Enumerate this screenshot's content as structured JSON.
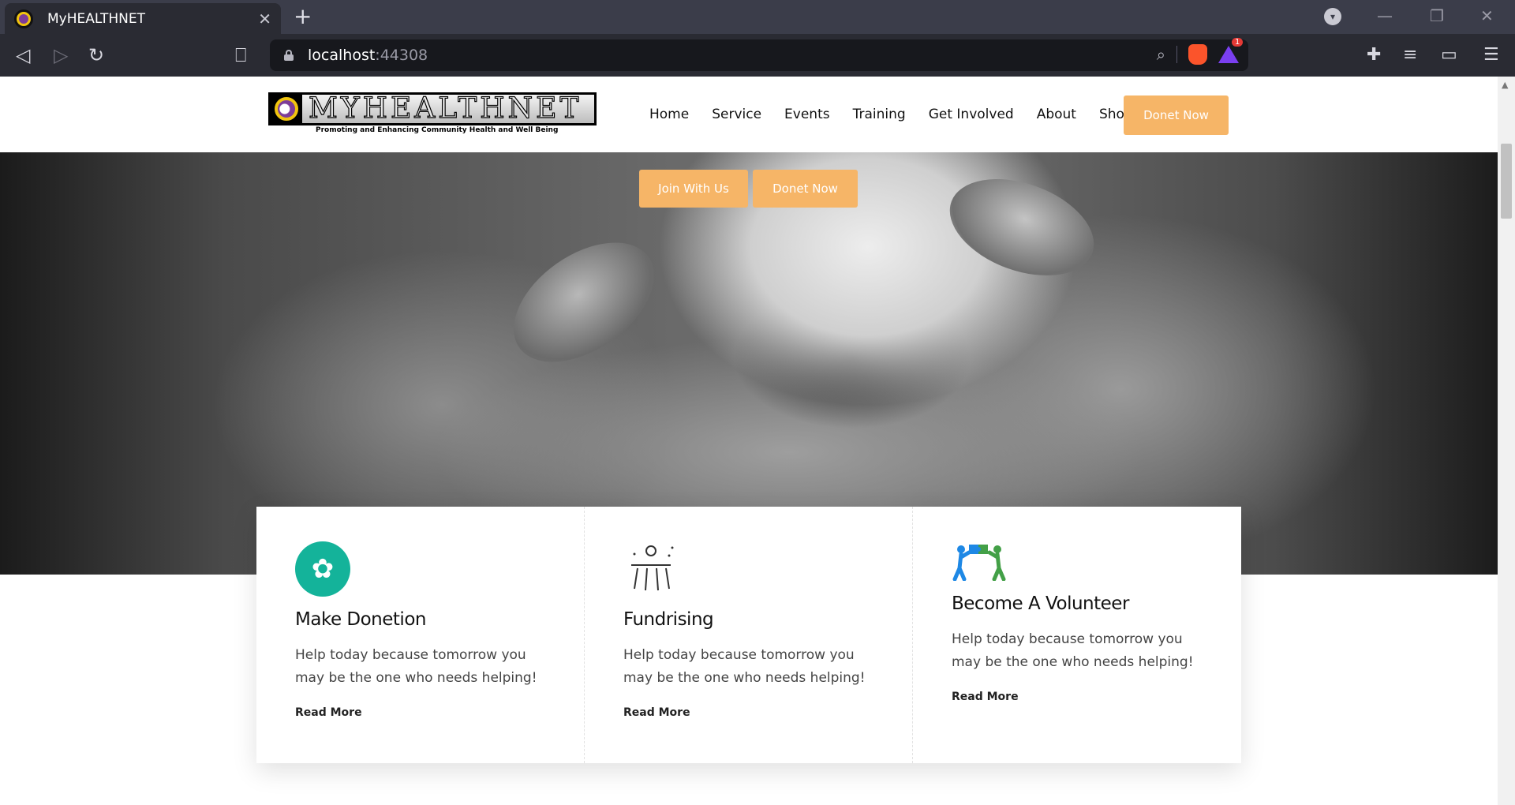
{
  "browser": {
    "tab_title": "MyHEALTHNET",
    "url_host": "localhost",
    "url_port": ":44308",
    "rewards_badge": "1"
  },
  "header": {
    "logo_text": "MYHEALTHNET",
    "logo_tagline": "Promoting and Enhancing Community Health and Well Being",
    "nav": [
      "Home",
      "Service",
      "Events",
      "Training",
      "Get Involved",
      "About",
      "Shop"
    ],
    "cta_label": "Donet Now"
  },
  "hero": {
    "join_label": "Join With Us",
    "donate_label": "Donet Now"
  },
  "cards": [
    {
      "icon": "brain-icon",
      "title": "Make Donetion",
      "text": "Help today because tomorrow you may be the one who needs helping!",
      "link": "Read More"
    },
    {
      "icon": "fundraising-icon",
      "title": "Fundrising",
      "text": "Help today because tomorrow you may be the one who needs helping!",
      "link": "Read More"
    },
    {
      "icon": "volunteer-puzzle-icon",
      "title": "Become A Volunteer",
      "text": "Help today because tomorrow you may be the one who needs helping!",
      "link": "Read More"
    }
  ],
  "colors": {
    "accent_orange": "#f6b567",
    "brain_teal": "#14b39a",
    "chrome_dark": "#2a2b33"
  }
}
